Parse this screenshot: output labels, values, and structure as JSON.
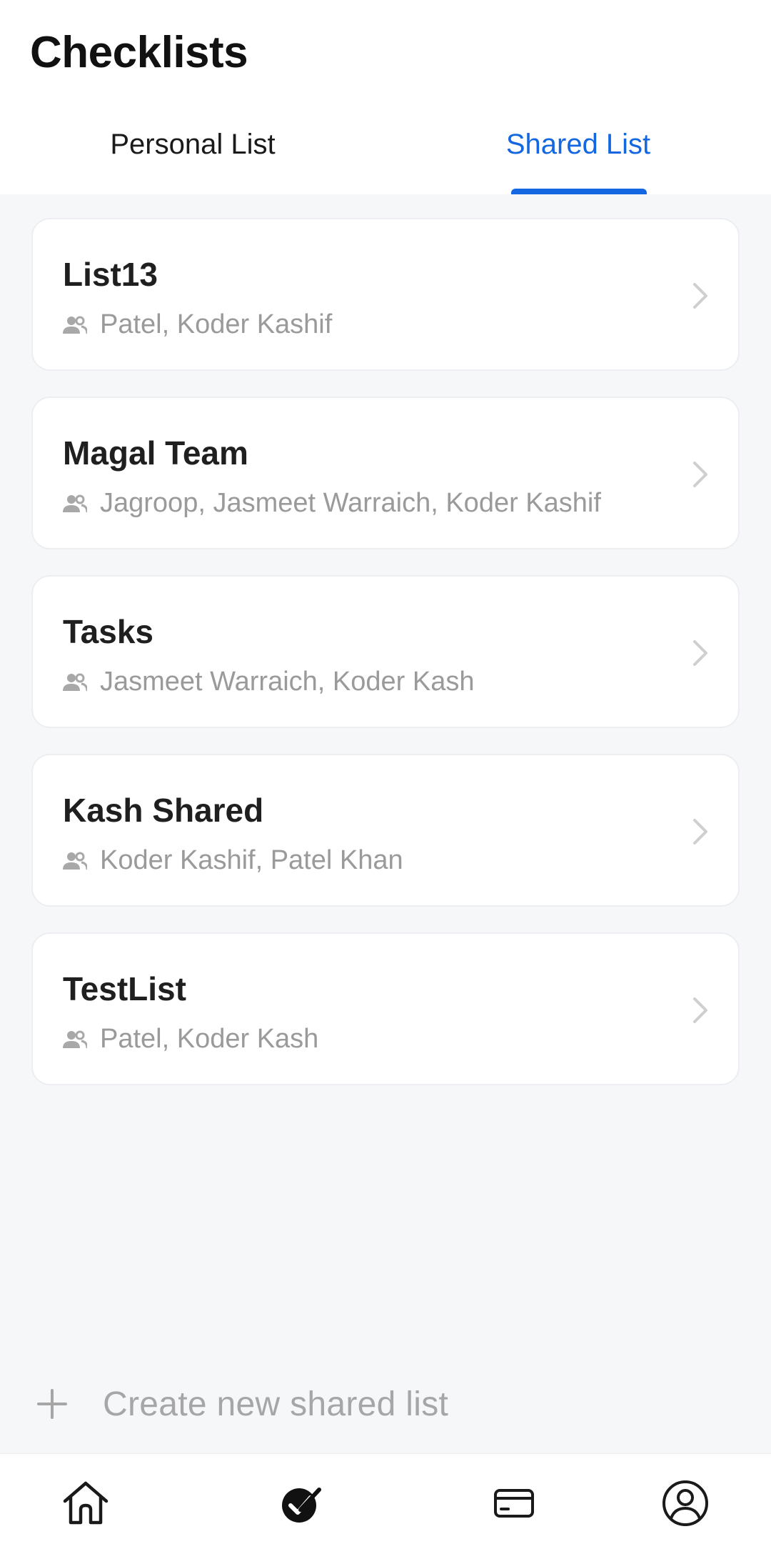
{
  "header": {
    "title": "Checklists",
    "tabs": [
      {
        "label": "Personal List",
        "active": false
      },
      {
        "label": "Shared List",
        "active": true
      }
    ]
  },
  "lists": [
    {
      "name": "List13",
      "members": "Patel, Koder Kashif"
    },
    {
      "name": "Magal Team",
      "members": "Jagroop, Jasmeet Warraich, Koder Kashif"
    },
    {
      "name": "Tasks",
      "members": "Jasmeet Warraich, Koder Kash"
    },
    {
      "name": "Kash Shared",
      "members": "Koder Kashif, Patel Khan"
    },
    {
      "name": "TestList",
      "members": "Patel, Koder Kash"
    }
  ],
  "create": {
    "label": "Create new shared list",
    "icon": "plus-icon"
  },
  "bottom_nav": [
    {
      "icon": "home-icon",
      "active": false
    },
    {
      "icon": "checklist-icon",
      "active": true
    },
    {
      "icon": "card-icon",
      "active": false
    },
    {
      "icon": "profile-icon",
      "active": false
    }
  ],
  "colors": {
    "accent": "#1467e0",
    "background": "#f6f7f9",
    "muted_text": "#9a9a9a"
  }
}
